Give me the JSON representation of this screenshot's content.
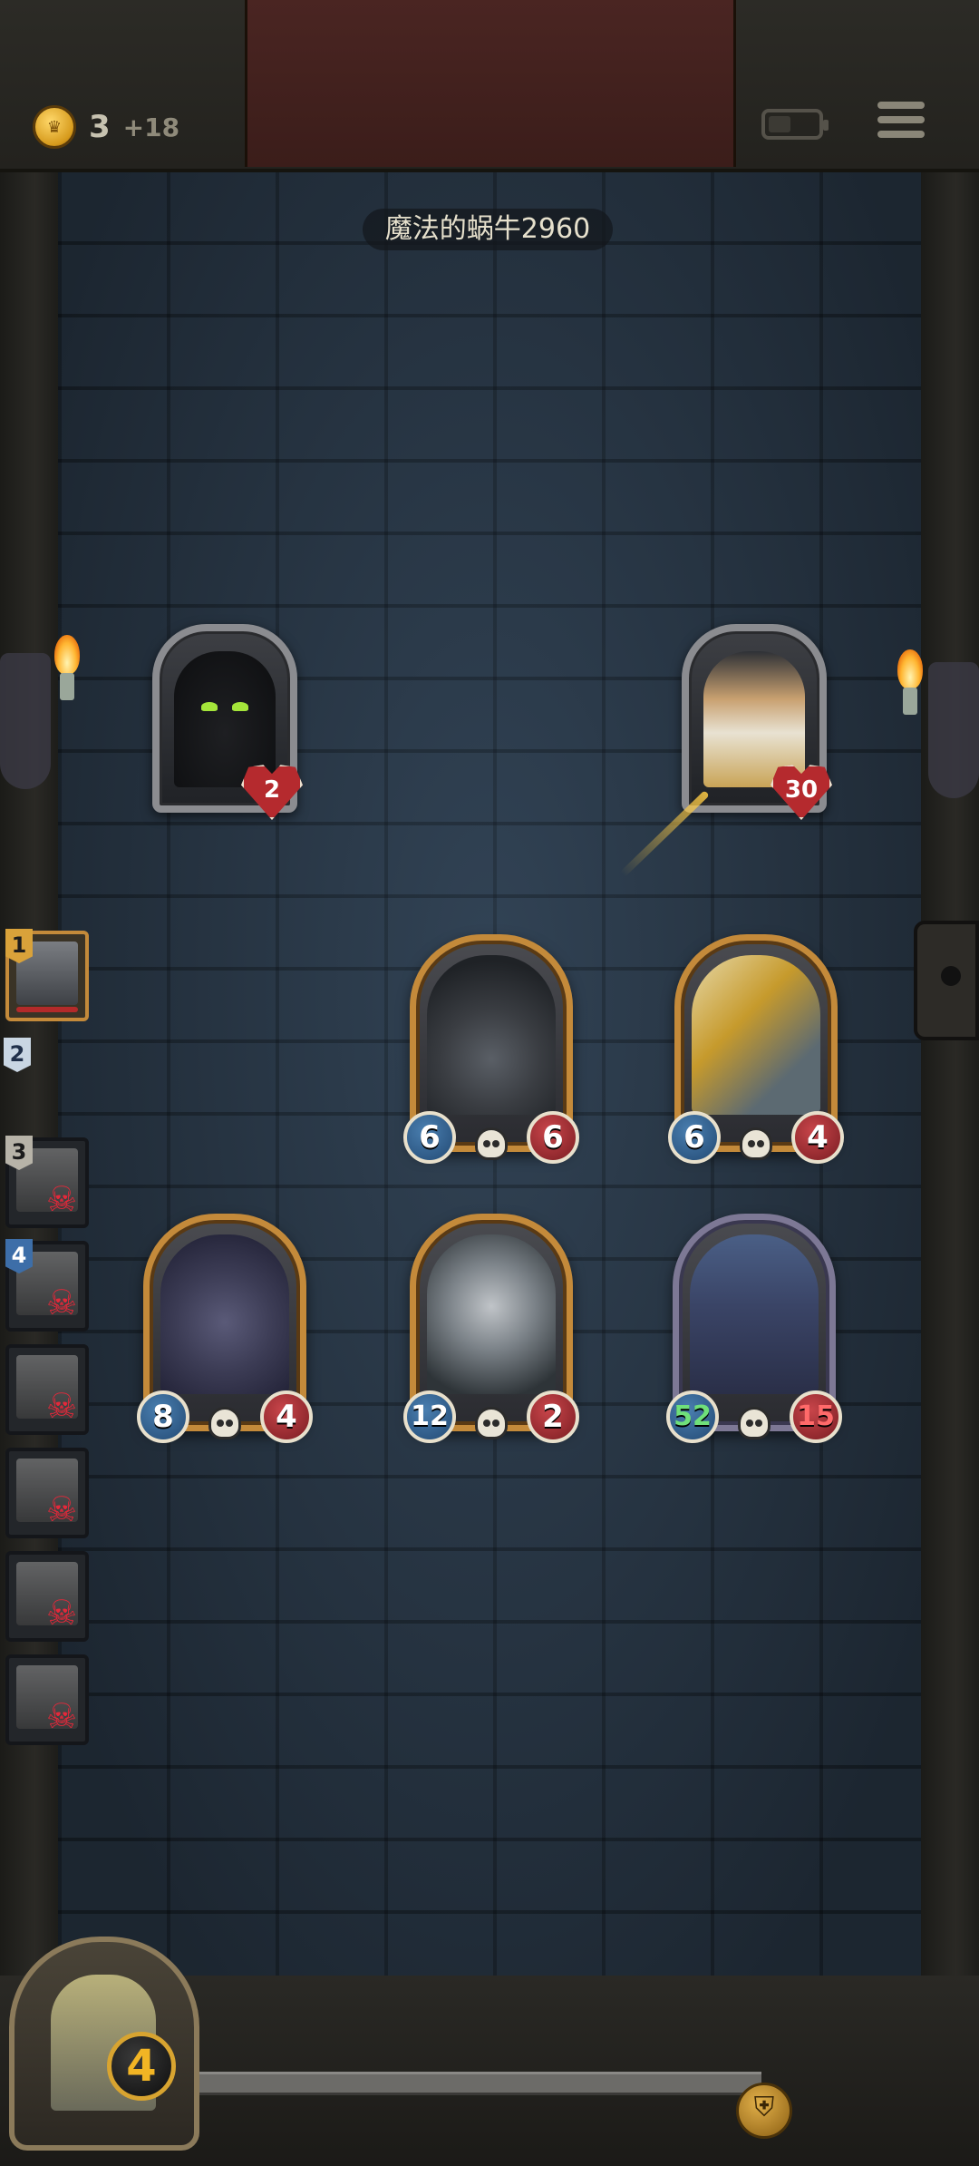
{
  "top_bar": {
    "gold": "3",
    "gold_income": "+18"
  },
  "opponent": {
    "name": "魔法的蜗牛2960"
  },
  "heroes": {
    "enemy_hero": {
      "health": "2",
      "icon": "shadow-demon-icon"
    },
    "player_hero": {
      "health": "30",
      "icon": "warrior-hero-icon"
    }
  },
  "minions": [
    {
      "attack": "6",
      "health": "6",
      "icon": "bomb-bot-icon",
      "golden": false
    },
    {
      "attack": "6",
      "health": "4",
      "icon": "golden-dragon-icon",
      "golden": false
    },
    {
      "attack": "8",
      "health": "4",
      "icon": "purple-dragon-whelp-icon",
      "golden": false
    },
    {
      "attack": "12",
      "health": "2",
      "icon": "robot-icon",
      "golden": false
    },
    {
      "attack": "52",
      "health": "15",
      "icon": "old-wizard-icon",
      "golden": true
    }
  ],
  "players": [
    {
      "rank": "1",
      "status": "active"
    },
    {
      "rank": "2",
      "status": "alive"
    },
    {
      "rank": "3",
      "status": "dead"
    },
    {
      "rank": "4",
      "status": "dead"
    },
    {
      "rank": "",
      "status": "dead"
    },
    {
      "rank": "",
      "status": "dead"
    },
    {
      "rank": "",
      "status": "dead"
    },
    {
      "rank": "",
      "status": "dead"
    }
  ],
  "tavern": {
    "tier": "4"
  },
  "colors": {
    "gold": "#d69a1c",
    "attack": "#2f5f8f",
    "health": "#b52a2e",
    "card_border": "#c48a3a",
    "wall": "#2b3a4a"
  }
}
